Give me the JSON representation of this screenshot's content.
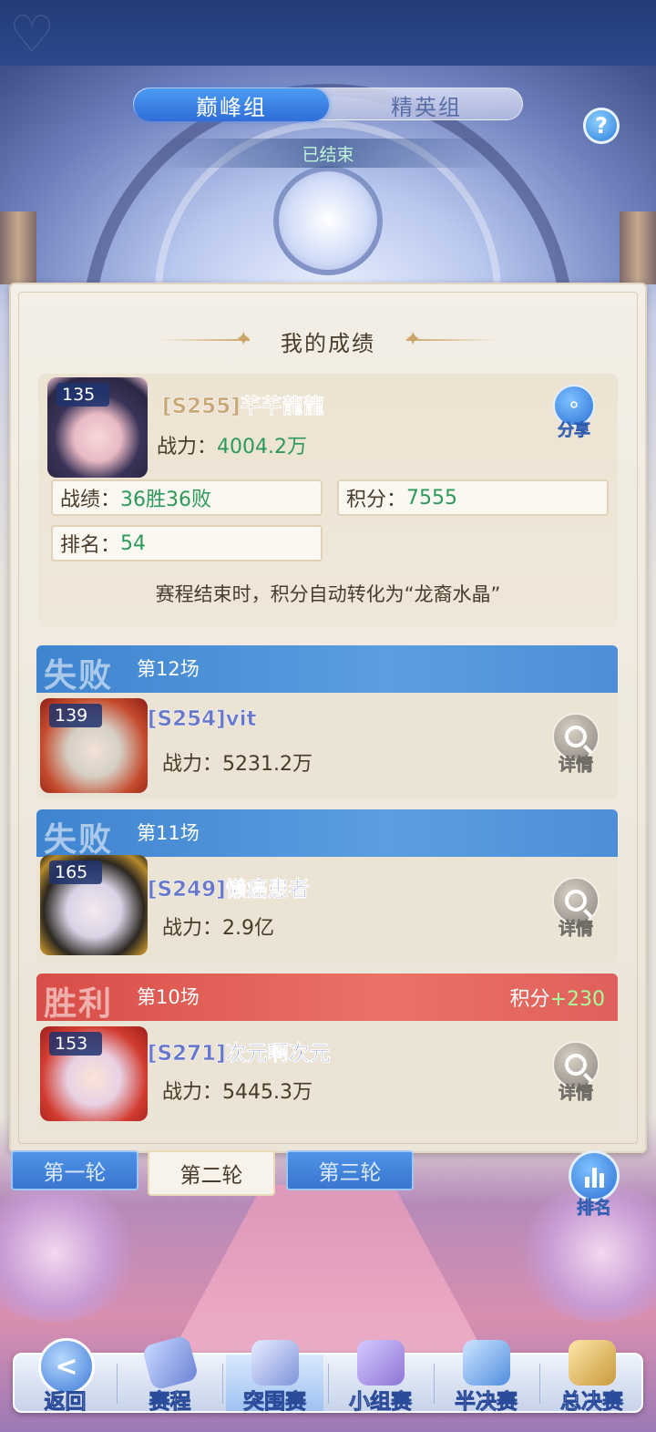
{
  "group_tabs": [
    {
      "label": "巅峰组",
      "active": true
    },
    {
      "label": "精英组",
      "active": false
    }
  ],
  "status": "已结束",
  "help_icon": "?",
  "section_title": "我的成绩",
  "me": {
    "level": "135",
    "name": "[S255]芊芊龍龍",
    "power_label": "战力：",
    "power_value": "4004.2万",
    "record_label": "战绩：",
    "record_value": "36胜36败",
    "score_label": "积分：",
    "score_value": "7555",
    "rank_label": "排名：",
    "rank_value": "54",
    "share_label": "分享"
  },
  "note": "赛程结束时，积分自动转化为“龙裔水晶”",
  "matches": [
    {
      "result": "失败",
      "round": "第12场",
      "score_label": "",
      "score_value": "",
      "level": "139",
      "name": "[S254]vit",
      "power_label": "战力：",
      "power_value": "5231.2万",
      "detail_label": "详情"
    },
    {
      "result": "失败",
      "round": "第11场",
      "score_label": "",
      "score_value": "",
      "level": "165",
      "name": "[S249]懒癌患者",
      "power_label": "战力：",
      "power_value": "2.9亿",
      "detail_label": "详情"
    },
    {
      "result": "胜利",
      "round": "第10场",
      "score_label": "积分",
      "score_value": "+230",
      "level": "153",
      "name": "[S271]次元啊次元",
      "power_label": "战力：",
      "power_value": "5445.3万",
      "detail_label": "详情"
    }
  ],
  "round_tabs": [
    {
      "label": "第一轮",
      "active": false
    },
    {
      "label": "第二轮",
      "active": true
    },
    {
      "label": "第三轮",
      "active": false
    }
  ],
  "rank_button": "排名",
  "bottom_nav": [
    {
      "label": "返回",
      "icon": "back-icon",
      "active": false
    },
    {
      "label": "赛程",
      "icon": "schedule-icon",
      "active": false
    },
    {
      "label": "突围赛",
      "icon": "breakout-icon",
      "active": true
    },
    {
      "label": "小组赛",
      "icon": "group-stage-icon",
      "active": false
    },
    {
      "label": "半决赛",
      "icon": "semifinal-icon",
      "active": false
    },
    {
      "label": "总决赛",
      "icon": "final-icon",
      "active": false
    }
  ],
  "colors": {
    "accent_blue": "#2f6ed8",
    "lose_header": "#4d8fd6",
    "win_header": "#e0605b",
    "value_green": "#2b9a5a",
    "panel_bg": "#efe8dc"
  }
}
